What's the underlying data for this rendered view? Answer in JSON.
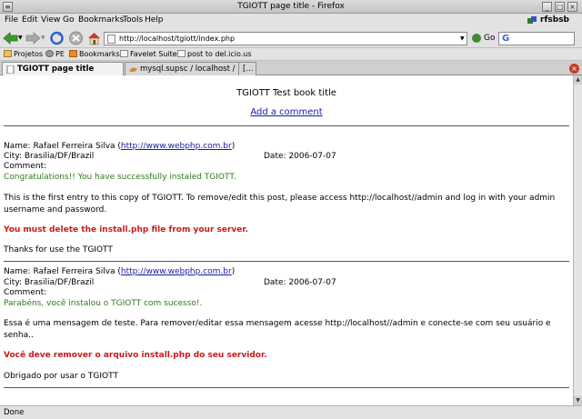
{
  "window": {
    "title": "TGIOTT page title - Firefox"
  },
  "menu": {
    "items": [
      "File",
      "Edit",
      "View",
      "Go",
      "Bookmarks",
      "Tools",
      "Help"
    ],
    "profile": "rfsbsb"
  },
  "nav": {
    "url": "http://localhost/tgiott/index.php",
    "go_label": "Go",
    "search_value": ""
  },
  "bookmarks": [
    "Projetos",
    "PE",
    "Bookmarks",
    "Favelet Suite",
    "post to del.icio.us"
  ],
  "tabs": [
    "TGIOTT page title",
    "mysql.supsc / localhost / livro",
    "[..."
  ],
  "page": {
    "book_title": "TGIOTT Test book title",
    "add_comment": "Add a comment",
    "entries": [
      {
        "name_label": "Name: Rafael Ferreira Silva (",
        "name_link": "http://www.webphp.com.br",
        "name_close": ")",
        "city": "City: Brasilia/DF/Brazil",
        "date": "Date: 2006-07-07",
        "comment_label": "Comment:",
        "comment_green": "Congratulations!! You have successfully instaled TGIOTT.",
        "body": "This is the first entry to this copy of TGIOTT. To remove/edit this post, please access http://localhost//admin and log in with your admin username and password.",
        "warning": "You must delete the install.php file from your server.",
        "thanks": "Thanks for use the TGIOTT"
      },
      {
        "name_label": "Name: Rafael Ferreira Silva (",
        "name_link": "http://www.webphp.com.br",
        "name_close": ")",
        "city": "City: Brasilia/DF/Brazil",
        "date": "Date: 2006-07-07",
        "comment_label": "Comment:",
        "comment_green": "Parabéns, você instalou o TGIOTT com sucesso!.",
        "body": "Essa é uma mensagem de teste. Para remover/editar essa mensagem acesse http://localhost//admin e conecte-se com seu usuário e senha..",
        "warning": "Você deve remover o arquivo install.php do seu servidor.",
        "thanks": "Obrigado por usar o TGIOTT"
      }
    ]
  },
  "status": {
    "text": "Done"
  },
  "colors": {
    "link": "#1a1aa6",
    "green_text": "#2f7a1c",
    "warning_red": "#c81a1a"
  }
}
